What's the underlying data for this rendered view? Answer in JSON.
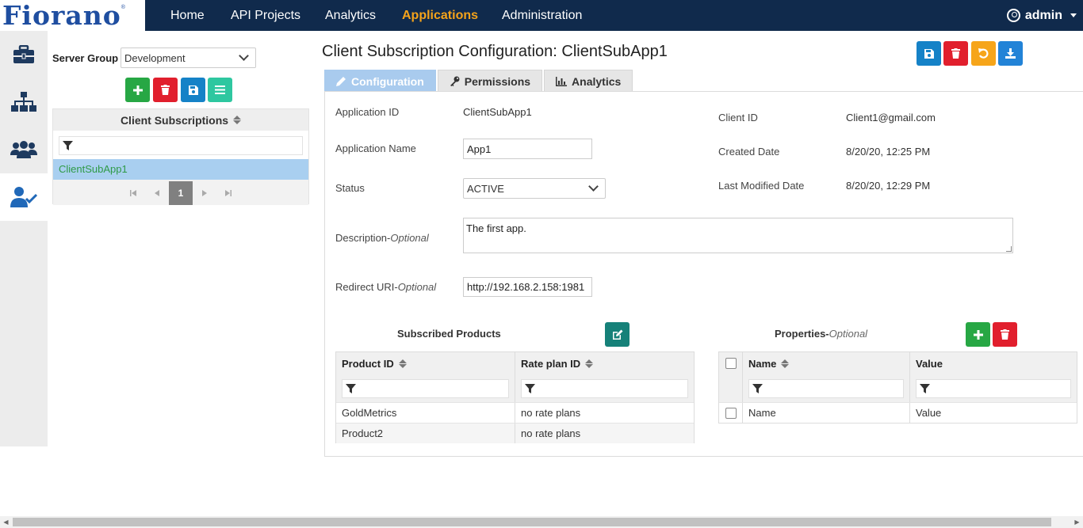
{
  "brand": {
    "logo_text": "Fiorano",
    "registered": "®"
  },
  "nav": {
    "items": [
      {
        "label": "Home",
        "active": false
      },
      {
        "label": "API Projects",
        "active": false
      },
      {
        "label": "Analytics",
        "active": false
      },
      {
        "label": "Applications",
        "active": true
      },
      {
        "label": "Administration",
        "active": false
      }
    ],
    "user": "admin"
  },
  "rail": {
    "items": [
      {
        "icon": "briefcase-icon"
      },
      {
        "icon": "sitemap-icon"
      },
      {
        "icon": "users-icon"
      },
      {
        "icon": "user-check-icon",
        "active": true
      }
    ]
  },
  "left": {
    "server_group_label": "Server Group",
    "server_group_value": "Development",
    "list_title": "Client Subscriptions",
    "items": [
      "ClientSubApp1"
    ],
    "page": "1"
  },
  "main": {
    "title": "Client Subscription Configuration: ClientSubApp1",
    "tabs": [
      {
        "label": "Configuration",
        "active": true,
        "icon": "pencil-icon"
      },
      {
        "label": "Permissions",
        "active": false,
        "icon": "key-icon"
      },
      {
        "label": "Analytics",
        "active": false,
        "icon": "bar-chart-icon"
      }
    ],
    "fields": {
      "app_id_label": "Application ID",
      "app_id_value": "ClientSubApp1",
      "app_name_label": "Application Name",
      "app_name_value": "App1",
      "status_label": "Status",
      "status_value": "ACTIVE",
      "desc_label": "Description-",
      "desc_optional": "Optional",
      "desc_value": "The first app.",
      "redirect_label": "Redirect URI-",
      "redirect_optional": "Optional",
      "redirect_value": "http://192.168.2.158:1981",
      "client_id_label": "Client ID",
      "client_id_value": "Client1@gmail.com",
      "created_label": "Created Date",
      "created_value": "8/20/20, 12:25 PM",
      "modified_label": "Last Modified Date",
      "modified_value": "8/20/20, 12:29 PM"
    },
    "products": {
      "title": "Subscribed Products",
      "columns": [
        "Product ID",
        "Rate plan ID"
      ],
      "rows": [
        [
          "GoldMetrics",
          "no rate plans"
        ],
        [
          "Product2",
          "no rate plans"
        ]
      ]
    },
    "properties": {
      "title": "Properties-",
      "optional": "Optional",
      "columns": [
        "Name",
        "Value"
      ],
      "rows": [
        [
          "Name",
          "Value"
        ]
      ]
    }
  }
}
